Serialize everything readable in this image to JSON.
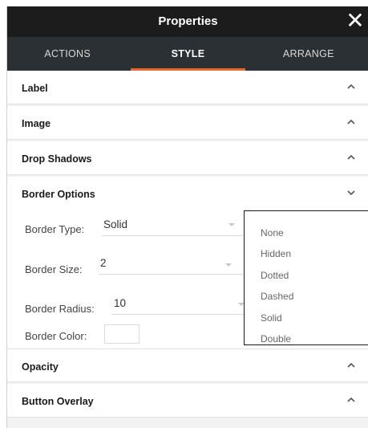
{
  "header": {
    "title": "Properties",
    "close_symbol": "✕"
  },
  "tabs": [
    {
      "label": "ACTIONS",
      "active": false
    },
    {
      "label": "STYLE",
      "active": true
    },
    {
      "label": "ARRANGE",
      "active": false
    }
  ],
  "accent_color": "#e8672b",
  "sections": {
    "label": {
      "title": "Label",
      "expanded": false
    },
    "image": {
      "title": "Image",
      "expanded": false
    },
    "drop_shadows": {
      "title": "Drop Shadows",
      "expanded": false
    },
    "border_options": {
      "title": "Border Options",
      "expanded": true
    },
    "opacity": {
      "title": "Opacity",
      "expanded": false
    },
    "button_overlay": {
      "title": "Button Overlay",
      "expanded": false
    }
  },
  "border_options": {
    "type_label": "Border Type:",
    "type_value": "Solid",
    "size_label": "Border Size:",
    "size_value": "2",
    "radius_label": "Border Radius:",
    "radius_value": "10",
    "color_label": "Border Color:",
    "color_value": "#ffffff"
  },
  "border_type_dropdown": {
    "options": [
      "None",
      "Hidden",
      "Dotted",
      "Dashed",
      "Solid",
      "Double"
    ]
  }
}
